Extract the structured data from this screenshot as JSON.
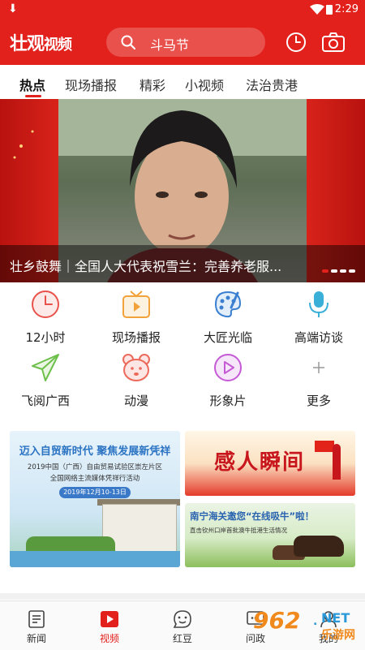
{
  "status_bar": {
    "time": "2:29"
  },
  "header": {
    "logo_main": "壮观",
    "logo_sub": "视频",
    "search_text": "斗马节",
    "accent_color": "#e3211c"
  },
  "tabs": [
    "热点",
    "现场播报",
    "精彩",
    "小视频",
    "法治贵港"
  ],
  "banner": {
    "caption": "壮乡鼓舞｜全国人大代表祝雪兰：完善养老服...",
    "slide_count": 4,
    "active_slide": 1
  },
  "categories": [
    {
      "label": "12小时",
      "icon": "clock-icon",
      "color": "#e8524a"
    },
    {
      "label": "现场播报",
      "icon": "tv-icon",
      "color": "#f2a23a"
    },
    {
      "label": "大匠光临",
      "icon": "palette-icon",
      "color": "#3a7fd0"
    },
    {
      "label": "高端访谈",
      "icon": "microphone-icon",
      "color": "#3ab0d8"
    },
    {
      "label": "飞阅广西",
      "icon": "paper-plane-icon",
      "color": "#6cc04a"
    },
    {
      "label": "动漫",
      "icon": "bear-icon",
      "color": "#ec6a5c"
    },
    {
      "label": "形象片",
      "icon": "play-circle-icon",
      "color": "#c65ad6"
    },
    {
      "label": "更多",
      "icon": "plus-icon",
      "color": "#999999"
    }
  ],
  "promos": {
    "fta": {
      "headline": "迈入自贸新时代  聚焦发展新凭祥",
      "line1": "2019中国（广西）自由贸易试验区崇左片区",
      "line2": "全国网络主流媒体凭祥行活动",
      "date": "2019年12月10-13日"
    },
    "moments": {
      "title": "感人瞬间"
    },
    "customs": {
      "headline": "南宁海关邀您“在线吸牛”啦！",
      "sub": "直击钦州口岸首批澳牛抵港生活情况"
    }
  },
  "bottom_nav": [
    {
      "label": "新闻",
      "icon": "news-icon"
    },
    {
      "label": "视频",
      "icon": "video-icon"
    },
    {
      "label": "红豆",
      "icon": "chat-face-icon"
    },
    {
      "label": "问政",
      "icon": "question-icon"
    },
    {
      "label": "我的",
      "icon": "user-icon"
    }
  ],
  "watermark": {
    "number": "962",
    "dot": ".",
    "net": "NET",
    "site": "乐游网"
  }
}
